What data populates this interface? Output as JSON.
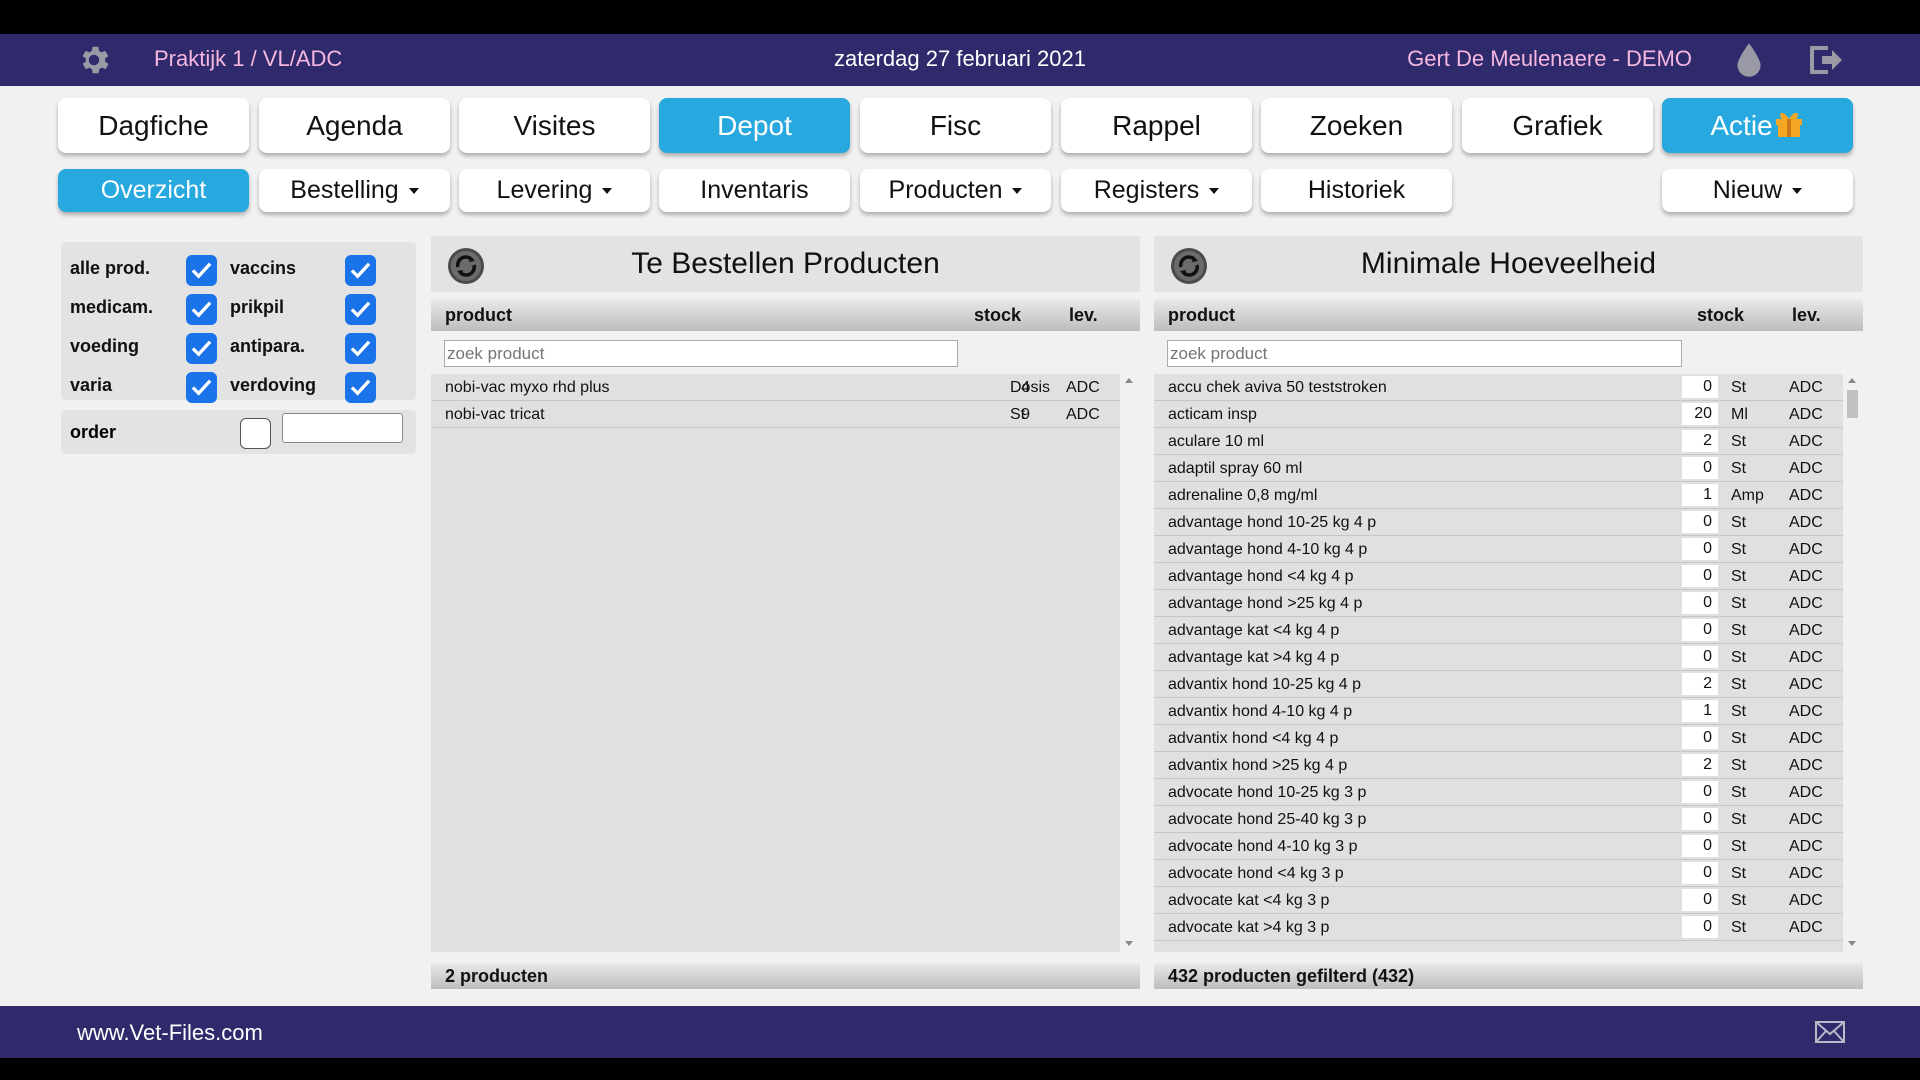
{
  "header": {
    "practice": "Praktijk 1 / VL/ADC",
    "date": "zaterdag 27 februari 2021",
    "user": "Gert De Meulenaere - DEMO"
  },
  "tabs": [
    "Dagfiche",
    "Agenda",
    "Visites",
    "Depot",
    "Fisc",
    "Rappel",
    "Zoeken",
    "Grafiek",
    "Actie"
  ],
  "subtabs": [
    "Overzicht",
    "Bestelling",
    "Levering",
    "Inventaris",
    "Producten",
    "Registers",
    "Historiek",
    "Nieuw"
  ],
  "filters": {
    "left": [
      "alle prod.",
      "medicam.",
      "voeding",
      "varia"
    ],
    "right": [
      "vaccins",
      "prikpil",
      "antipara.",
      "verdoving"
    ],
    "order_label": "order"
  },
  "panel_left": {
    "title": "Te Bestellen Producten",
    "col_product": "product",
    "col_stock": "stock",
    "col_lev": "lev.",
    "search_placeholder": "zoek product",
    "rows": [
      {
        "product": "nobi-vac myxo rhd plus",
        "qty": "4",
        "unit": "Dosis",
        "lev": "ADC"
      },
      {
        "product": "nobi-vac tricat",
        "qty": "9",
        "unit": "St",
        "lev": "ADC"
      }
    ],
    "footer": "2 producten"
  },
  "panel_right": {
    "title": "Minimale Hoeveelheid",
    "col_product": "product",
    "col_stock": "stock",
    "col_lev": "lev.",
    "search_placeholder": "zoek product",
    "rows": [
      {
        "product": "accu chek aviva 50 teststroken",
        "qty": "0",
        "unit": "St",
        "lev": "ADC"
      },
      {
        "product": "acticam insp",
        "qty": "20",
        "unit": "Ml",
        "lev": "ADC"
      },
      {
        "product": "aculare 10 ml",
        "qty": "2",
        "unit": "St",
        "lev": "ADC"
      },
      {
        "product": "adaptil spray 60 ml",
        "qty": "0",
        "unit": "St",
        "lev": "ADC"
      },
      {
        "product": "adrenaline 0,8 mg/ml",
        "qty": "1",
        "unit": "Amp",
        "lev": "ADC"
      },
      {
        "product": "advantage hond 10-25 kg 4 p",
        "qty": "0",
        "unit": "St",
        "lev": "ADC"
      },
      {
        "product": "advantage hond 4-10 kg 4 p",
        "qty": "0",
        "unit": "St",
        "lev": "ADC"
      },
      {
        "product": "advantage hond <4 kg 4 p",
        "qty": "0",
        "unit": "St",
        "lev": "ADC"
      },
      {
        "product": "advantage hond >25 kg 4 p",
        "qty": "0",
        "unit": "St",
        "lev": "ADC"
      },
      {
        "product": "advantage kat <4 kg 4 p",
        "qty": "0",
        "unit": "St",
        "lev": "ADC"
      },
      {
        "product": "advantage kat >4 kg 4 p",
        "qty": "0",
        "unit": "St",
        "lev": "ADC"
      },
      {
        "product": "advantix hond 10-25 kg 4 p",
        "qty": "2",
        "unit": "St",
        "lev": "ADC"
      },
      {
        "product": "advantix hond 4-10 kg 4 p",
        "qty": "1",
        "unit": "St",
        "lev": "ADC"
      },
      {
        "product": "advantix hond <4 kg 4 p",
        "qty": "0",
        "unit": "St",
        "lev": "ADC"
      },
      {
        "product": "advantix hond >25 kg 4 p",
        "qty": "2",
        "unit": "St",
        "lev": "ADC"
      },
      {
        "product": "advocate hond 10-25 kg 3 p",
        "qty": "0",
        "unit": "St",
        "lev": "ADC"
      },
      {
        "product": "advocate hond 25-40 kg 3 p",
        "qty": "0",
        "unit": "St",
        "lev": "ADC"
      },
      {
        "product": "advocate hond 4-10 kg 3 p",
        "qty": "0",
        "unit": "St",
        "lev": "ADC"
      },
      {
        "product": "advocate hond <4 kg 3 p",
        "qty": "0",
        "unit": "St",
        "lev": "ADC"
      },
      {
        "product": "advocate kat <4 kg 3 p",
        "qty": "0",
        "unit": "St",
        "lev": "ADC"
      },
      {
        "product": "advocate kat >4 kg 3 p",
        "qty": "0",
        "unit": "St",
        "lev": "ADC"
      }
    ],
    "footer": "432 producten gefilterd (432)"
  },
  "footer": {
    "site": "www.Vet-Files.com"
  },
  "colors": {
    "bar": "#2f2a6b",
    "accent": "#27a9e0",
    "pink_text": "#f6b7e0",
    "checkbox": "#1a73e8"
  }
}
